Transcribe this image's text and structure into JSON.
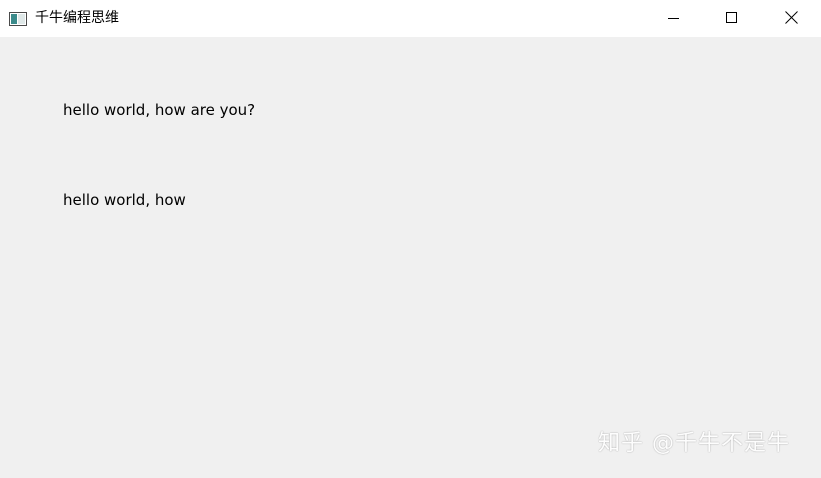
{
  "window": {
    "title": "千牛编程思维",
    "controls": {
      "minimize": "minimize-icon",
      "maximize": "maximize-icon",
      "close": "close-icon"
    }
  },
  "content": {
    "label_full": "hello world, how are you?",
    "label_clipped": "hello world, how are you?"
  },
  "watermark": {
    "text": "知乎 @千牛不是牛"
  },
  "colors": {
    "titlebar_bg": "#ffffff",
    "client_bg": "#f0f0f0",
    "text": "#000000"
  }
}
